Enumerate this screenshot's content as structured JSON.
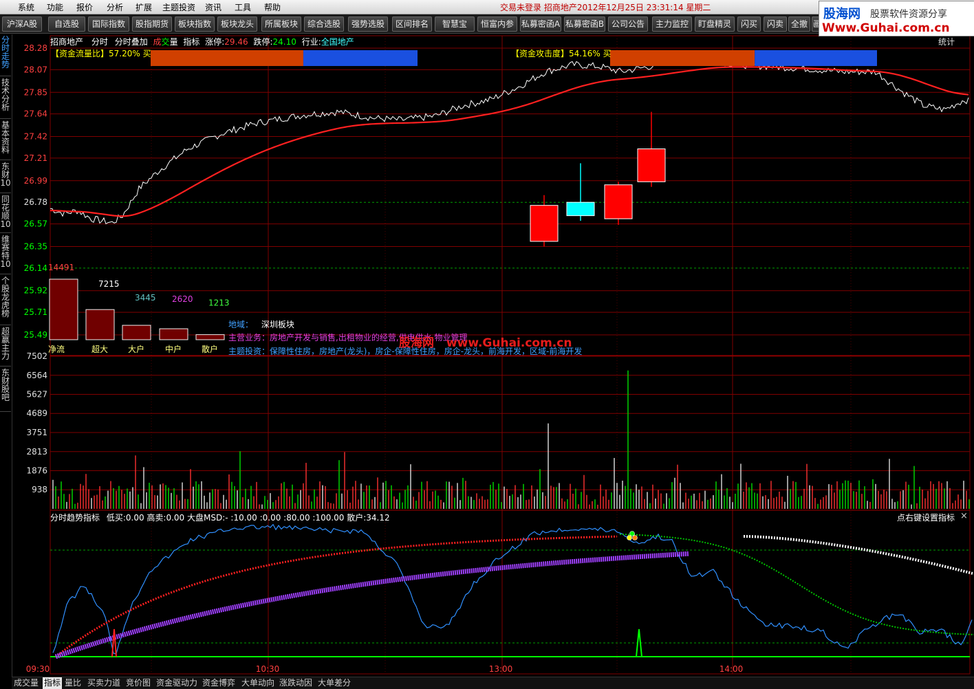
{
  "menubar": {
    "items": [
      "系统",
      "功能",
      "报价",
      "分析",
      "扩展",
      "主题投资",
      "资讯",
      "工具",
      "帮助"
    ],
    "status": "交易未登录   招商地产2012年12月25日  23:31:14  星期二"
  },
  "brand": {
    "name": "股海网",
    "slogan": "股票软件资源分享",
    "url": "Www.Guhai.com.cn"
  },
  "toolbar": {
    "buttons": [
      "沪深A股",
      "自选股",
      "国际指数",
      "股指期货",
      "板块指数",
      "板块龙头",
      "所属板块",
      "综合选股",
      "强势选股",
      "区间排名",
      "智慧宝",
      "恒富内参",
      "私募密函A",
      "私募密函B",
      "公司公告",
      "主力监控",
      "盯盘精灵",
      "闪买",
      "闪卖",
      "全撤",
      "画"
    ]
  },
  "sidebar": {
    "tabs": [
      "分时走势",
      "技术分析",
      "基本资料",
      "东财10",
      "同花顺10",
      "维赛特10",
      "个股龙虎榜",
      "超赢主力",
      "东财股吧"
    ]
  },
  "header": {
    "stock_name": "招商地产",
    "items": [
      "分时",
      "分时叠加"
    ],
    "chengjiao_a": "成",
    "chengjiao_b": "交",
    "chengjiao_c": "量",
    "zhibiao": "指标",
    "limit_up_label": "涨停:",
    "limit_up_value": "29.46",
    "limit_down_label": "跌停:",
    "limit_down_value": "24.10",
    "industry_label": "行业:",
    "industry_value": "全国地产",
    "stats_label": "统计"
  },
  "fund_flow": {
    "left_label": "【资金流量比】",
    "left_value": "57.20% 买",
    "left_ratio": 0.572,
    "right_label": "【资金攻击度】",
    "right_value": "54.16% 买",
    "right_ratio": 0.5416
  },
  "price_axis": [
    "28.28",
    "28.07",
    "27.85",
    "27.64",
    "27.42",
    "27.21",
    "26.99",
    "26.78",
    "26.57",
    "26.35",
    "26.14",
    "25.92",
    "25.71",
    "25.49"
  ],
  "vol_axis": [
    "7502",
    "6564",
    "5627",
    "4689",
    "3751",
    "2813",
    "1876",
    "938"
  ],
  "time_axis": [
    "09:30",
    "10:30",
    "13:00",
    "14:00"
  ],
  "candles": [
    {
      "open": 26.75,
      "close": 26.4,
      "high": 26.85,
      "low": 26.35,
      "color": "#ff0000"
    },
    {
      "open": 26.65,
      "close": 26.78,
      "high": 27.16,
      "low": 26.6,
      "color": "#00ffff"
    },
    {
      "open": 26.95,
      "close": 26.62,
      "high": 26.98,
      "low": 26.56,
      "color": "#ff0000"
    },
    {
      "open": 27.3,
      "close": 26.98,
      "high": 27.66,
      "low": 26.93,
      "color": "#ff0000"
    }
  ],
  "money_flow": {
    "bars": [
      {
        "label": "净流",
        "value": "14491",
        "amount": 14491,
        "color": "#ff4040"
      },
      {
        "label": "超大",
        "value": "7215",
        "amount": 7215,
        "color": "#ffffff"
      },
      {
        "label": "大户",
        "value": "3445",
        "amount": 3445,
        "color": "#60c0c0"
      },
      {
        "label": "中户",
        "value": "2620",
        "amount": 2620,
        "color": "#e040e0"
      },
      {
        "label": "散户",
        "value": "1213",
        "amount": 1213,
        "color": "#40ff40"
      }
    ]
  },
  "company": {
    "region_label": "地域：",
    "region_value": "深圳板块",
    "business_label": "主营业务：",
    "business_value": "房地产开发与销售,出租物业的经营,供电供水,物业管理",
    "theme_label": "主题投资：",
    "theme_value": "保障性住房，房地产(龙头)，房企-保障性住房，房企-龙头，前海开发，区域-前海开发"
  },
  "watermark": {
    "cn": "股海网",
    "url": "www.Guhai.com.cn"
  },
  "indicator": {
    "title": "分时趋势指标",
    "params": "低买:0.00  高卖:0.00  大盘MSD:- :10.00  :0.00  :80.00  :100.00  散户:34.12",
    "right_hint": "点右键设置指标",
    "close_icon": "×"
  },
  "bottom_tabs": [
    "成交量",
    "指标",
    "量比",
    "买卖力道",
    "竞价图",
    "资金驱动力",
    "资金博弈",
    "大单动向",
    "涨跌动因",
    "大单差分"
  ],
  "colors": {
    "grid": "#800000",
    "price": "#ffffff",
    "avg": "#ff2020",
    "up": "#ff0000",
    "down": "#00ff00",
    "axis_text": "#ff4040"
  }
}
